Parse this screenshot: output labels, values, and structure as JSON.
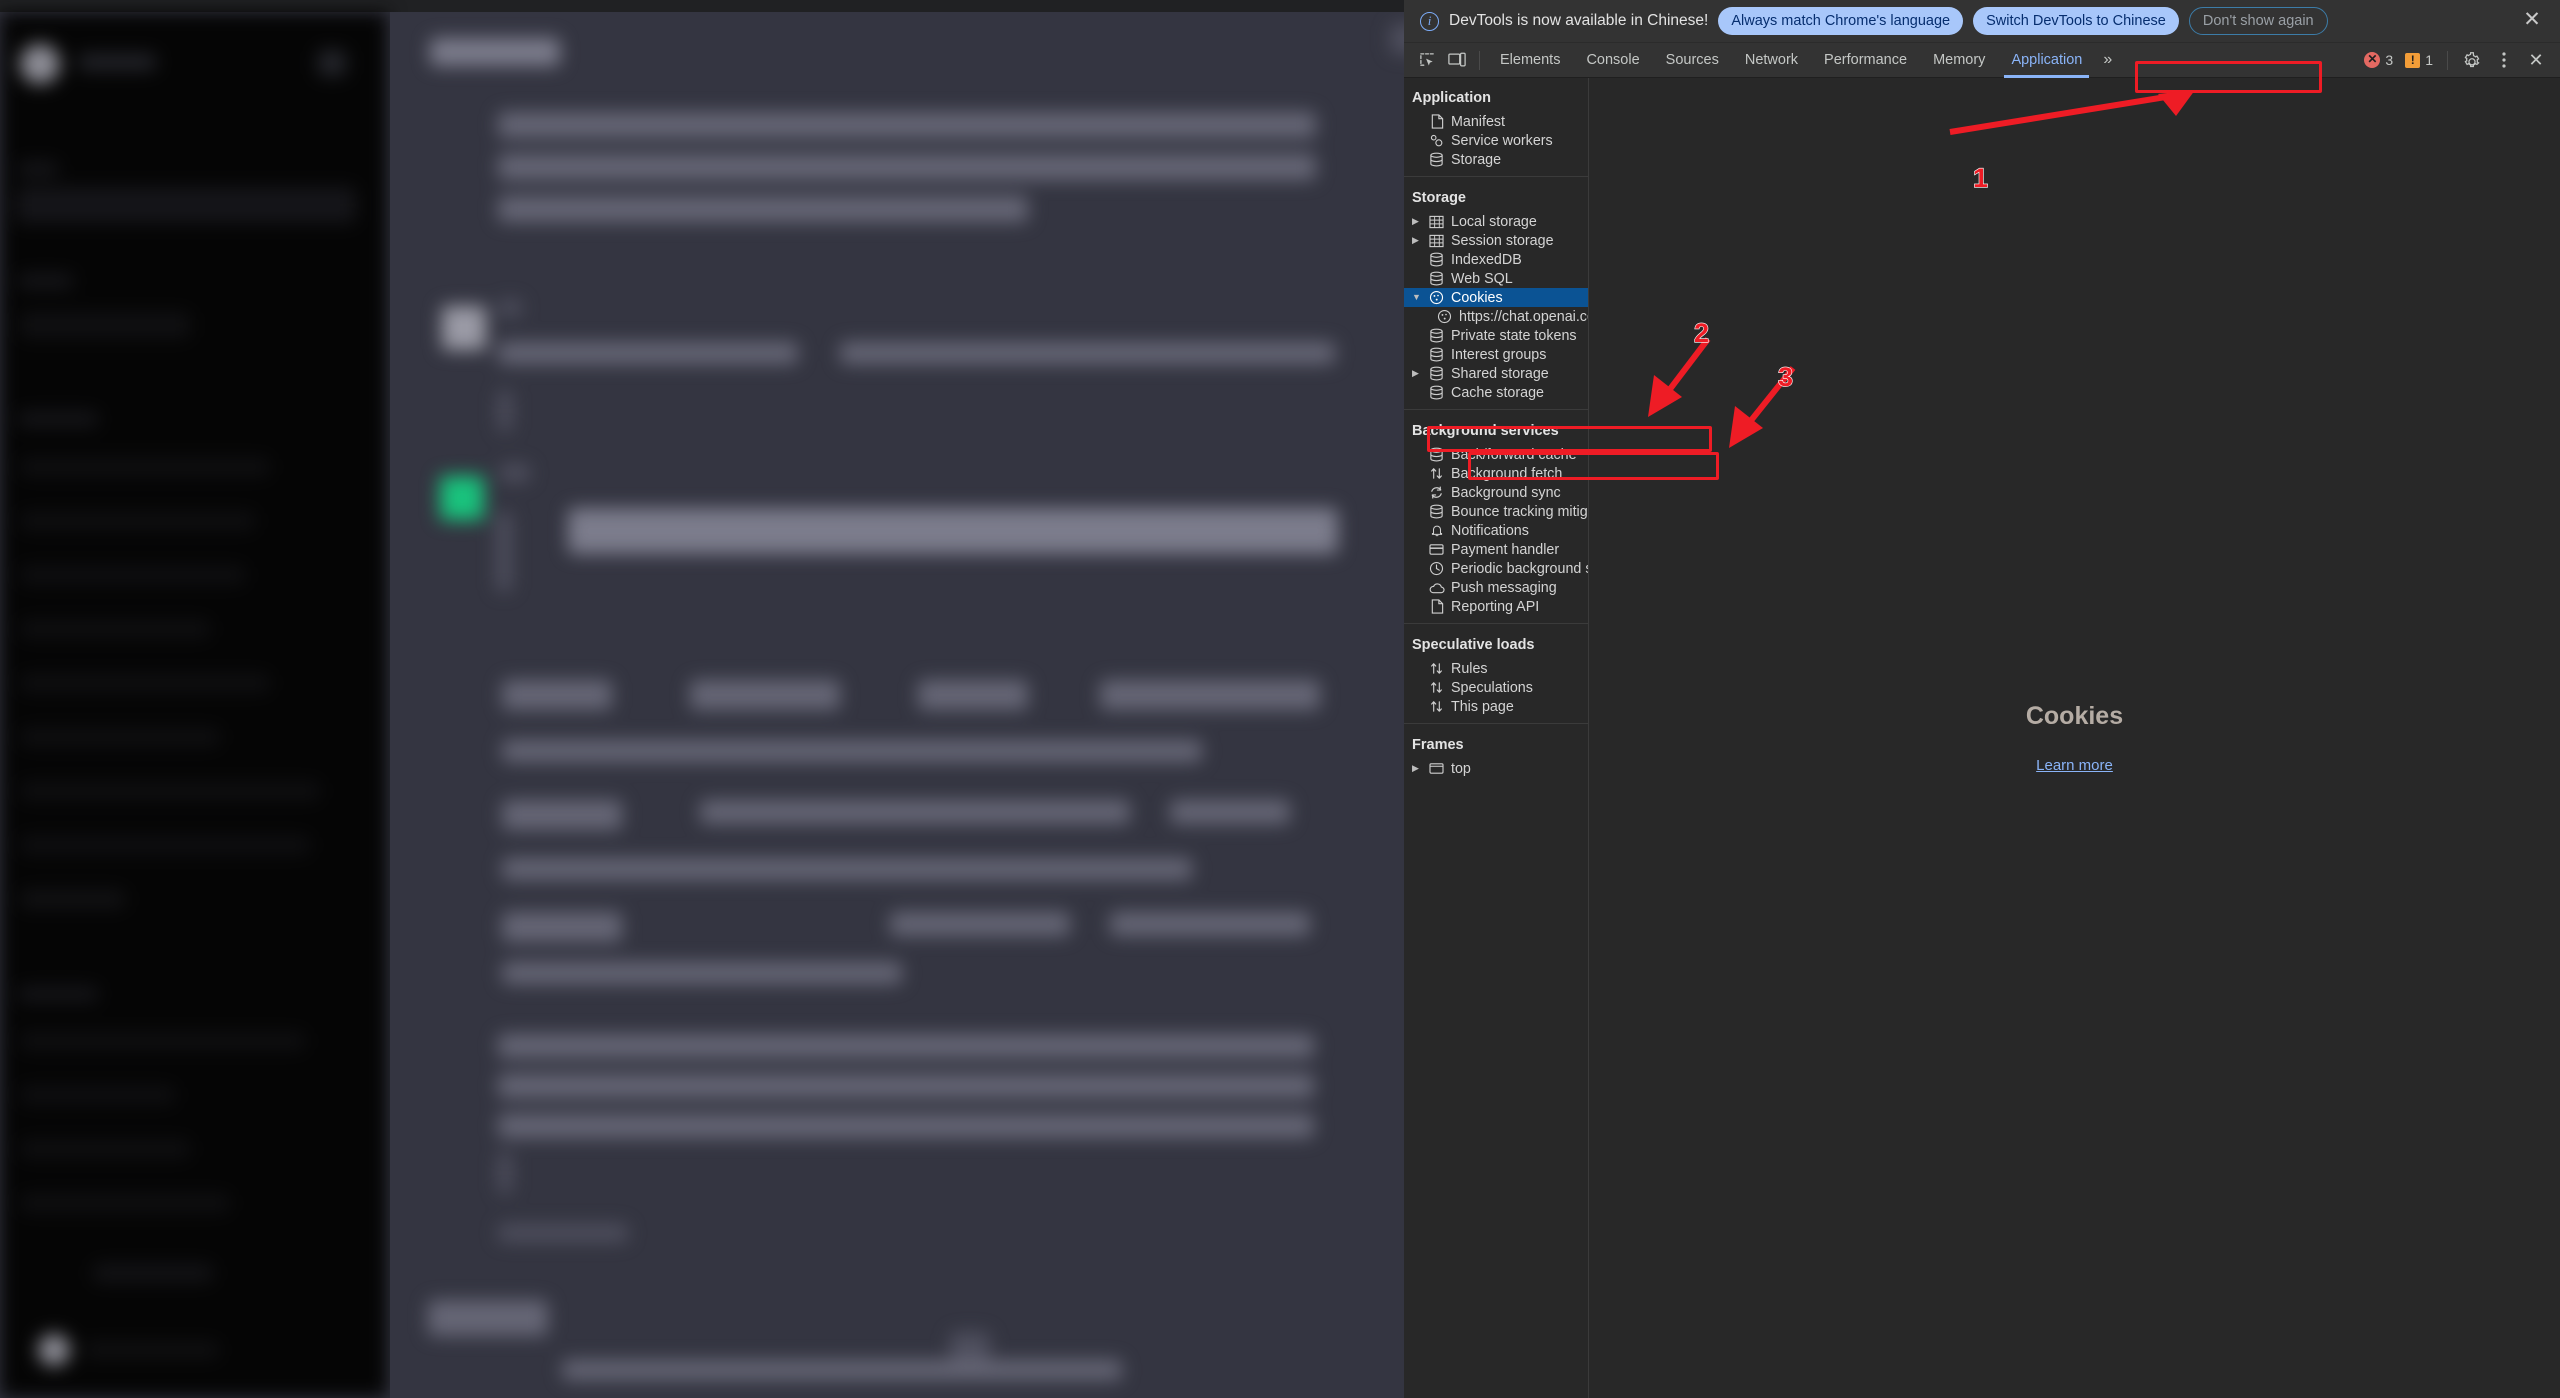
{
  "banner": {
    "message": "DevTools is now available in Chinese!",
    "info_icon": "info-icon",
    "buttons": [
      {
        "label": "Always match Chrome's language",
        "style": "primary"
      },
      {
        "label": "Switch DevTools to Chinese",
        "style": "primary"
      },
      {
        "label": "Don't show again",
        "style": "ghost"
      }
    ],
    "close_icon": "✕"
  },
  "toolbar": {
    "inspect_icon": "inspect-element-icon",
    "device_icon": "device-toolbar-icon",
    "tabs": [
      {
        "label": "Elements",
        "active": false
      },
      {
        "label": "Console",
        "active": false
      },
      {
        "label": "Sources",
        "active": false
      },
      {
        "label": "Network",
        "active": false
      },
      {
        "label": "Performance",
        "active": false
      },
      {
        "label": "Memory",
        "active": false
      },
      {
        "label": "Application",
        "active": true
      }
    ],
    "more_tabs_icon": "»",
    "error_count": "3",
    "warning_count": "1",
    "settings_icon": "gear-icon",
    "kebab_icon": "more-options-icon",
    "close_icon": "✕"
  },
  "sidebar": {
    "groups": [
      {
        "title": "Application",
        "items": [
          {
            "label": "Manifest",
            "icon": "document-icon",
            "expandable": false,
            "selected": false,
            "child": false
          },
          {
            "label": "Service workers",
            "icon": "gears-icon",
            "expandable": false,
            "selected": false,
            "child": false
          },
          {
            "label": "Storage",
            "icon": "database-icon",
            "expandable": false,
            "selected": false,
            "child": false
          }
        ]
      },
      {
        "title": "Storage",
        "items": [
          {
            "label": "Local storage",
            "icon": "table-icon",
            "expandable": true,
            "expanded": false,
            "selected": false,
            "child": false
          },
          {
            "label": "Session storage",
            "icon": "table-icon",
            "expandable": true,
            "expanded": false,
            "selected": false,
            "child": false
          },
          {
            "label": "IndexedDB",
            "icon": "database-icon",
            "expandable": false,
            "selected": false,
            "child": false
          },
          {
            "label": "Web SQL",
            "icon": "database-icon",
            "expandable": false,
            "selected": false,
            "child": false
          },
          {
            "label": "Cookies",
            "icon": "cookie-icon",
            "expandable": true,
            "expanded": true,
            "selected": true,
            "child": false
          },
          {
            "label": "https://chat.openai.com",
            "icon": "cookie-icon",
            "expandable": false,
            "selected": false,
            "child": true
          },
          {
            "label": "Private state tokens",
            "icon": "database-icon",
            "expandable": false,
            "selected": false,
            "child": false
          },
          {
            "label": "Interest groups",
            "icon": "database-icon",
            "expandable": false,
            "selected": false,
            "child": false
          },
          {
            "label": "Shared storage",
            "icon": "database-icon",
            "expandable": true,
            "expanded": false,
            "selected": false,
            "child": false
          },
          {
            "label": "Cache storage",
            "icon": "database-icon",
            "expandable": false,
            "selected": false,
            "child": false
          }
        ]
      },
      {
        "title": "Background services",
        "items": [
          {
            "label": "Back/forward cache",
            "icon": "database-icon",
            "expandable": false,
            "selected": false,
            "child": false
          },
          {
            "label": "Background fetch",
            "icon": "arrows-updown-icon",
            "expandable": false,
            "selected": false,
            "child": false
          },
          {
            "label": "Background sync",
            "icon": "sync-icon",
            "expandable": false,
            "selected": false,
            "child": false
          },
          {
            "label": "Bounce tracking mitigations",
            "icon": "database-icon",
            "expandable": false,
            "selected": false,
            "child": false
          },
          {
            "label": "Notifications",
            "icon": "bell-icon",
            "expandable": false,
            "selected": false,
            "child": false
          },
          {
            "label": "Payment handler",
            "icon": "card-icon",
            "expandable": false,
            "selected": false,
            "child": false
          },
          {
            "label": "Periodic background sync",
            "icon": "clock-icon",
            "expandable": false,
            "selected": false,
            "child": false
          },
          {
            "label": "Push messaging",
            "icon": "cloud-icon",
            "expandable": false,
            "selected": false,
            "child": false
          },
          {
            "label": "Reporting API",
            "icon": "document-icon",
            "expandable": false,
            "selected": false,
            "child": false
          }
        ]
      },
      {
        "title": "Speculative loads",
        "items": [
          {
            "label": "Rules",
            "icon": "arrows-updown-icon",
            "expandable": false,
            "selected": false,
            "child": false
          },
          {
            "label": "Speculations",
            "icon": "arrows-updown-icon",
            "expandable": false,
            "selected": false,
            "child": false
          },
          {
            "label": "This page",
            "icon": "arrows-updown-icon",
            "expandable": false,
            "selected": false,
            "child": false
          }
        ]
      },
      {
        "title": "Frames",
        "items": [
          {
            "label": "top",
            "icon": "frame-icon",
            "expandable": true,
            "expanded": false,
            "selected": false,
            "child": false
          }
        ]
      }
    ]
  },
  "main": {
    "title": "Cookies",
    "link": "Learn more"
  },
  "annotations": {
    "color": "#ee1c25",
    "markers": [
      {
        "number": "1",
        "target": "Application tab"
      },
      {
        "number": "2",
        "target": "Cookies tree item"
      },
      {
        "number": "3",
        "target": "https://chat.openai.com cookie origin"
      }
    ]
  }
}
